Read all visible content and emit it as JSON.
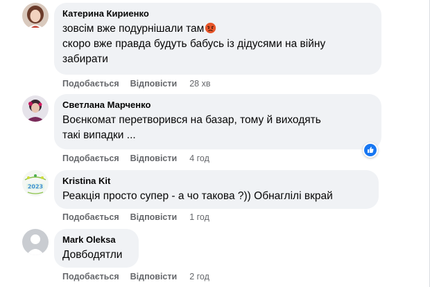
{
  "comments": [
    {
      "author": "Катерина Кириенко",
      "lines": [
        "зовсім вже подурнішали там",
        "скоро вже правда будуть бабусь із дідусями на війну",
        "забирати"
      ],
      "like_label": "Подобається",
      "reply_label": "Відповісти",
      "time": "28 хв",
      "emoji_icon": "angry-face-emoji-icon"
    },
    {
      "author": "Светлана Марченко",
      "lines": [
        "Воєнкомат перетворився на базар, тому й виходять",
        "такі випадки ..."
      ],
      "like_label": "Подобається",
      "reply_label": "Відповісти",
      "time": "4 год",
      "reaction_icon": "like-reaction-icon"
    },
    {
      "author": "Kristina Kit",
      "lines": [
        "Реакція просто супер - а чо такова ?)) Обнаглілі вкрай"
      ],
      "like_label": "Подобається",
      "reply_label": "Відповісти",
      "time": "1 год"
    },
    {
      "author": "Mark Oleksa",
      "lines": [
        "Довбодятли"
      ],
      "like_label": "Подобається",
      "reply_label": "Відповісти",
      "time": "2 год"
    }
  ],
  "colors": {
    "bubble": "#f0f2f5",
    "meta_text": "#65676b",
    "like_blue": "#1877f2"
  }
}
